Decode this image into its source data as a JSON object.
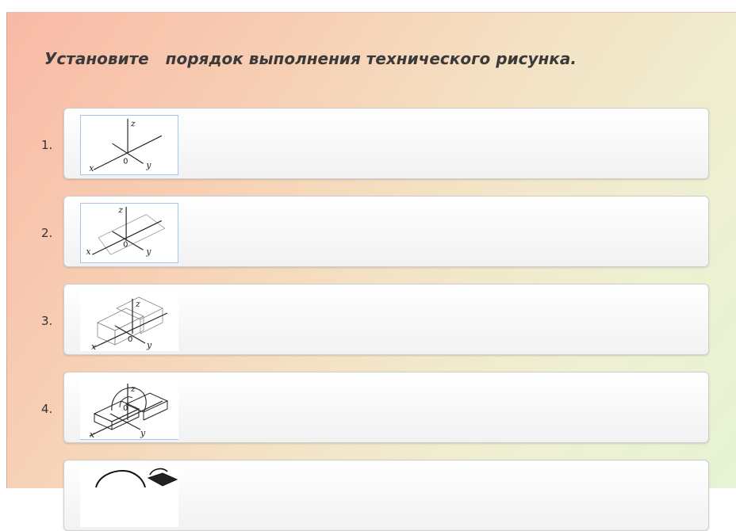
{
  "title": "Установите   порядок выполнения технического рисунка.",
  "items": [
    {
      "number": "1.",
      "image": "axes-sketch"
    },
    {
      "number": "2.",
      "image": "axes-with-construction-lines-sketch"
    },
    {
      "number": "3.",
      "image": "bounding-boxes-sketch"
    },
    {
      "number": "4.",
      "image": "detailed-part-sketch"
    },
    {
      "number": "",
      "image": "finished-part-sketch"
    }
  ],
  "axis_labels": {
    "x": "x",
    "y": "y",
    "z": "z",
    "origin": "0"
  }
}
